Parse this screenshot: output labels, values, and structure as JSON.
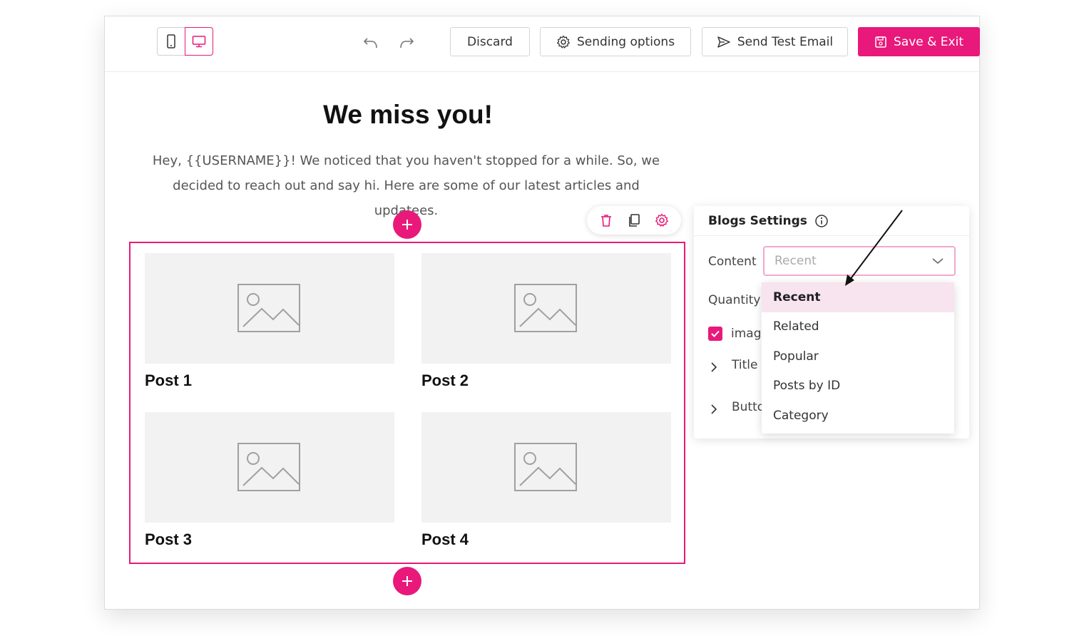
{
  "toolbar": {
    "discard_label": "Discard",
    "sending_options_label": "Sending options",
    "send_test_label": "Send Test Email",
    "save_exit_label": "Save & Exit"
  },
  "email": {
    "headline": "We miss you!",
    "intro": "Hey, {{USERNAME}}! We noticed that you haven't stopped for a while. So, we decided to reach out and say hi. Here are some of our latest articles and updatees."
  },
  "posts": [
    {
      "title": "Post 1"
    },
    {
      "title": "Post 2"
    },
    {
      "title": "Post 3"
    },
    {
      "title": "Post 4"
    }
  ],
  "blogs_settings": {
    "title": "Blogs Settings",
    "content_label": "Content",
    "content_value": "Recent",
    "quantity_label": "Quantity",
    "image_label": "image",
    "image_checked": true,
    "title_section": "Title",
    "button_section": "Butto"
  },
  "dropdown_options": [
    "Recent",
    "Related",
    "Popular",
    "Posts by ID",
    "Category"
  ],
  "colors": {
    "accent": "#e8197a",
    "highlight": "#f7e4ee"
  }
}
